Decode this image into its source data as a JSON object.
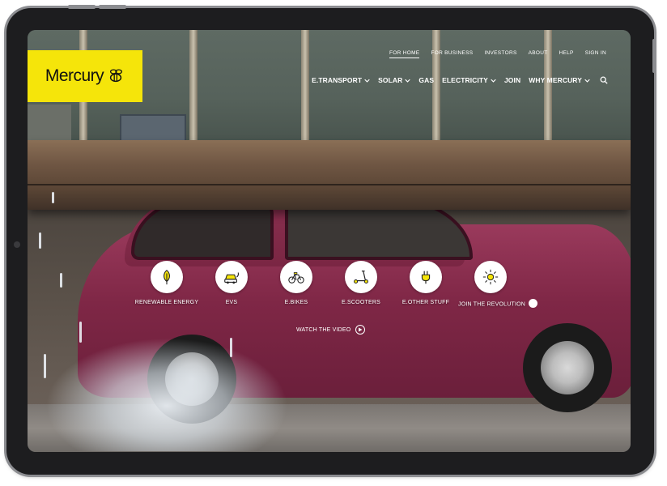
{
  "brand": {
    "name": "Mercury",
    "logo_color": "#f5e50a"
  },
  "top_nav": [
    {
      "label": "FOR HOME",
      "active": true
    },
    {
      "label": "FOR BUSINESS",
      "active": false
    },
    {
      "label": "INVESTORS",
      "active": false
    },
    {
      "label": "ABOUT",
      "active": false
    },
    {
      "label": "HELP",
      "active": false
    },
    {
      "label": "SIGN IN",
      "active": false
    }
  ],
  "main_nav": [
    {
      "label": "E.TRANSPORT",
      "has_dropdown": true
    },
    {
      "label": "SOLAR",
      "has_dropdown": true
    },
    {
      "label": "GAS",
      "has_dropdown": false
    },
    {
      "label": "ELECTRICITY",
      "has_dropdown": true
    },
    {
      "label": "JOIN",
      "has_dropdown": false
    },
    {
      "label": "WHY MERCURY",
      "has_dropdown": true
    }
  ],
  "search": {
    "icon": "search-icon"
  },
  "categories": [
    {
      "label": "RENEWABLE ENERGY",
      "icon": "leaf-icon"
    },
    {
      "label": "EVS",
      "icon": "car-plug-icon"
    },
    {
      "label": "E.BIKES",
      "icon": "bike-icon"
    },
    {
      "label": "E.SCOOTERS",
      "icon": "scooter-icon"
    },
    {
      "label": "E.OTHER STUFF",
      "icon": "plug-icon"
    },
    {
      "label": "JOIN THE REVOLUTION",
      "icon": "sun-icon"
    }
  ],
  "video_cta": {
    "label": "WATCH THE VIDEO",
    "icon": "play-icon"
  },
  "colors": {
    "accent_yellow": "#f5e50a",
    "text_white": "#ffffff"
  }
}
